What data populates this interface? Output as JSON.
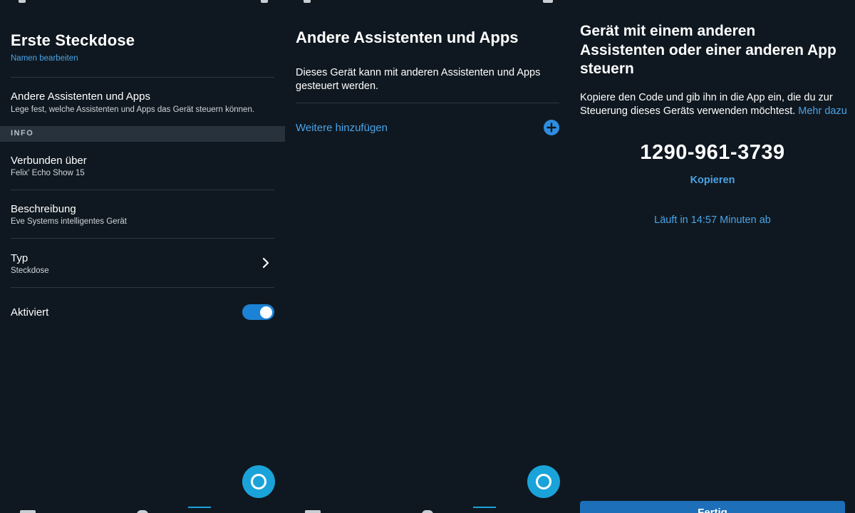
{
  "screen1": {
    "title": "Erste Steckdose",
    "edit_name_link": "Namen bearbeiten",
    "assistants_row": {
      "title": "Andere Assistenten und Apps",
      "subtitle": "Lege fest, welche Assistenten und Apps das Gerät steuern können."
    },
    "info_section_header": "INFO",
    "connected_row": {
      "title": "Verbunden über",
      "subtitle": "Felix' Echo Show 15"
    },
    "description_row": {
      "title": "Beschreibung",
      "subtitle": "Eve Systems intelligentes Gerät"
    },
    "type_row": {
      "title": "Typ",
      "subtitle": "Steckdose"
    },
    "enabled_row": {
      "title": "Aktiviert",
      "toggle_on": true
    }
  },
  "screen2": {
    "title": "Andere Assistenten und Apps",
    "description": "Dieses Gerät kann mit anderen Assistenten und Apps gesteuert werden.",
    "add_more": "Weitere hinzufügen"
  },
  "screen3": {
    "title": "Gerät mit einem anderen Assistenten oder einer anderen App steuern",
    "description": "Kopiere den Code und gib ihn in die App ein, die du zur Steuerung dieses Geräts verwenden möchtest.",
    "learn_more": "Mehr dazu",
    "code": "1290-961-3739",
    "copy_button": "Kopieren",
    "expiry": "Läuft in 14:57 Minuten ab",
    "bottom_button": "Fertig"
  },
  "colors": {
    "background": "#0f1820",
    "accent_link": "#4ba3e6",
    "toggle_on": "#1c82d6",
    "alexa_button": "#1aa3d9",
    "section_header": "#27323c"
  }
}
